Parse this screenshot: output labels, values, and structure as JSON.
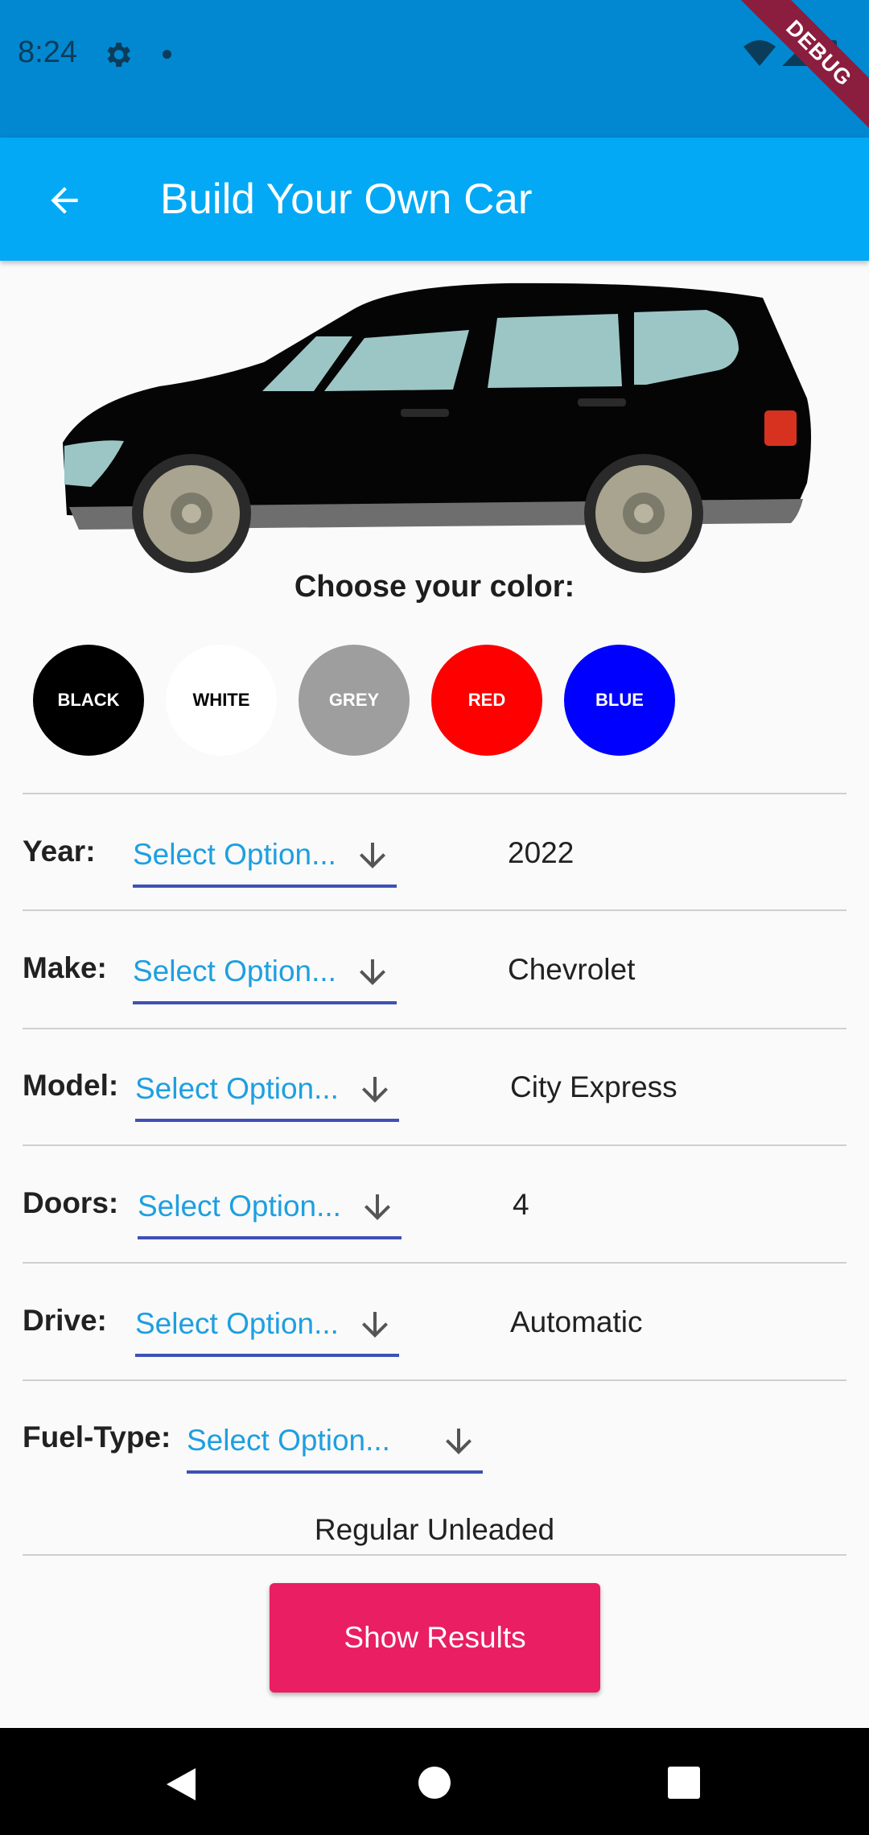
{
  "status_bar": {
    "time": "8:24",
    "debug_label": "DEBUG"
  },
  "app_bar": {
    "title": "Build Your Own Car"
  },
  "color_picker": {
    "heading": "Choose your color:",
    "options": [
      {
        "label": "BLACK",
        "color": "#000000",
        "text_color": "#ffffff"
      },
      {
        "label": "WHITE",
        "color": "#ffffff",
        "text_color": "#000000"
      },
      {
        "label": "GREY",
        "color": "#9e9e9e",
        "text_color": "#ffffff"
      },
      {
        "label": "RED",
        "color": "#ff0000",
        "text_color": "#ffffff"
      },
      {
        "label": "BLUE",
        "color": "#0000ff",
        "text_color": "#ffffff"
      }
    ]
  },
  "form": {
    "placeholder": "Select Option...",
    "rows": [
      {
        "label": "Year:",
        "value": "2022"
      },
      {
        "label": "Make:",
        "value": "Chevrolet"
      },
      {
        "label": "Model:",
        "value": "City Express"
      },
      {
        "label": "Doors:",
        "value": "4"
      },
      {
        "label": "Drive:",
        "value": "Automatic"
      },
      {
        "label": "Fuel-Type:",
        "value": "Regular Unleaded"
      }
    ]
  },
  "actions": {
    "show_results": "Show Results"
  },
  "colors": {
    "status_bar": "#0288d1",
    "app_bar": "#03a9f4",
    "accent": "#e91e63",
    "underline": "#3f51b5",
    "dropdown_text": "#1e9fe0"
  }
}
